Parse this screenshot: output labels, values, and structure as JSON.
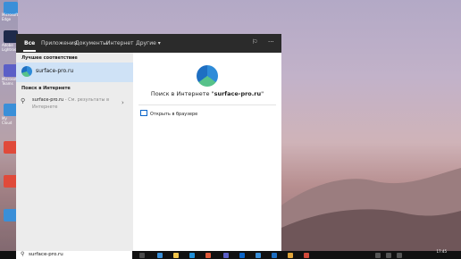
{
  "desktop": {
    "icons": [
      {
        "label": "Microsoft Edge",
        "color": "#3a8fd8"
      },
      {
        "label": "Adobe Lightroom",
        "color": "#1e2a4a"
      },
      {
        "label": "Microsoft Teams",
        "color": "#5b5fc7"
      },
      {
        "label": "My Cloud",
        "color": "#3a8fd8"
      },
      {
        "label": "",
        "color": "#e04a3a"
      },
      {
        "label": "",
        "color": "#e04a3a"
      },
      {
        "label": "",
        "color": "#3a8fd8"
      }
    ]
  },
  "panel": {
    "tabs": [
      "Все",
      "Приложения",
      "Документы",
      "Интернет",
      "Другие ▾"
    ],
    "icons": {
      "feedback": "feedback-icon",
      "more": "more-icon"
    },
    "best_match_heading": "Лучшее соответствие",
    "best_match_label": "surface-pro.ru",
    "web_heading": "Поиск в Интернете",
    "web_item_label": "surface-pro.ru",
    "web_item_sub": " - См. результаты в",
    "web_item_sub2": "Интернете",
    "preview_title_prefix": "Поиск в Интернете \"",
    "preview_title_query": "surface-pro.ru",
    "preview_title_suffix": "\"",
    "open_browser_label": "Открыть в браузере"
  },
  "taskbar": {
    "search_value": "surface-pro.ru",
    "time": "17:45"
  },
  "colors": {
    "accent": "#0a64c8",
    "selected_row": "#cfe2f6",
    "panel_header": "#2b2b2b"
  }
}
